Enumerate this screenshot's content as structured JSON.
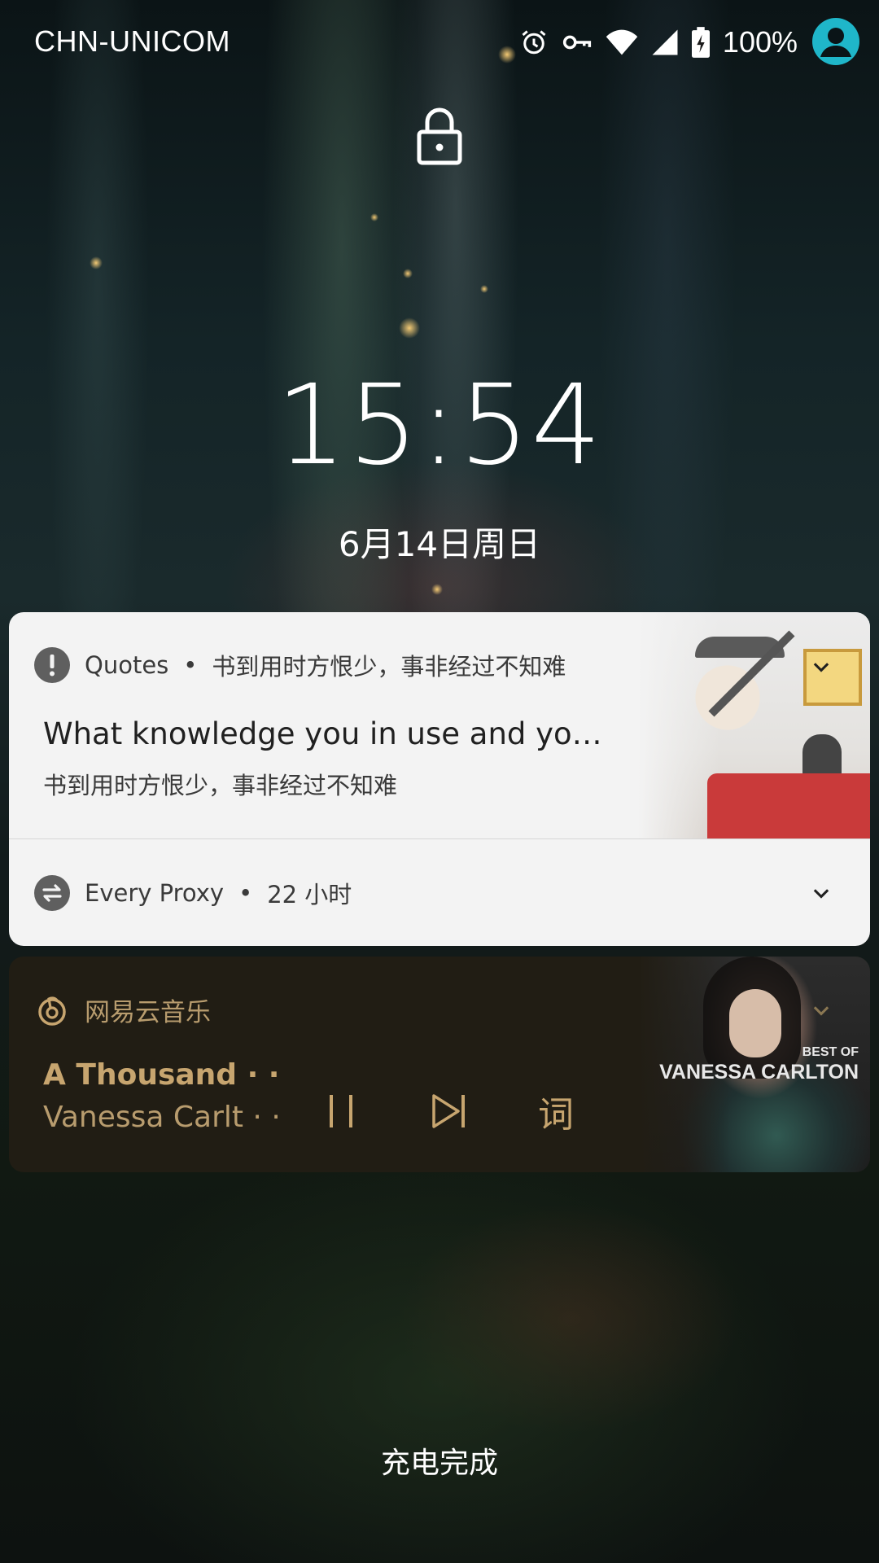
{
  "status_bar": {
    "carrier": "CHN-UNICOM",
    "battery_percent": "100%",
    "icons": [
      "alarm-icon",
      "vpn-key-icon",
      "wifi-icon",
      "cellular-signal-icon",
      "battery-charging-icon"
    ],
    "avatar_color": "#1fb6c9"
  },
  "lock_screen": {
    "lock_icon": "lock-icon",
    "time": "15:54",
    "date": "6月14日周日",
    "charging_status": "充电完成"
  },
  "notifications": [
    {
      "app": "Quotes",
      "header_text": "书到用时方恨少，事非经过不知难",
      "title": "What knowledge you in use and yo…",
      "body": "书到用时方恨少，事非经过不知难",
      "icon": "alert-icon"
    },
    {
      "app": "Every Proxy",
      "time": "22 小时",
      "icon": "swap-icon"
    }
  ],
  "media": {
    "app": "网易云音乐",
    "title": "A Thousand · ·",
    "artist": "Vanessa Carlt · ·",
    "album_label_top": "BEST OF",
    "album_label_bottom": "VANESSA CARLTON",
    "lyrics_label": "词",
    "accent_color": "#c7a56f",
    "card_color": "#211d14"
  },
  "separator": "•"
}
